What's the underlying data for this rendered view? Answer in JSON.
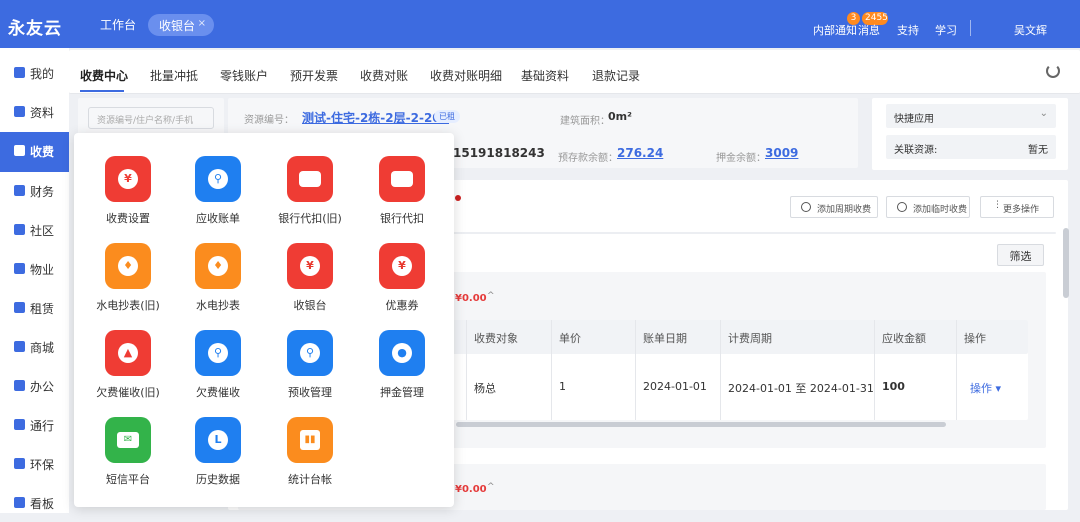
{
  "topbar": {
    "logo": "永友云",
    "workbench": "工作台",
    "open_tab": "收银台",
    "close": "×",
    "notice": "内部通知",
    "notice_badge": "3",
    "messages": "消息",
    "messages_badge": "2455",
    "support": "支持",
    "learn": "学习",
    "user": "吴文辉"
  },
  "sidebar": {
    "items": [
      {
        "label": "我的"
      },
      {
        "label": "资料"
      },
      {
        "label": "收费",
        "active": true
      },
      {
        "label": "财务"
      },
      {
        "label": "社区"
      },
      {
        "label": "物业"
      },
      {
        "label": "租赁"
      },
      {
        "label": "商城"
      },
      {
        "label": "办公"
      },
      {
        "label": "通行"
      },
      {
        "label": "环保"
      },
      {
        "label": "看板"
      }
    ]
  },
  "tabs": [
    "收费中心",
    "批量冲抵",
    "零钱账户",
    "预开发票",
    "收费对账",
    "收费对账明细",
    "基础资料",
    "退款记录"
  ],
  "search": {
    "placeholder": "资源编号/住户名称/手机"
  },
  "resource": {
    "label": "资源编号：",
    "value": "测试-住宅-2栋-2层-2-201",
    "tag": "已租",
    "area_label": "建筑面积：",
    "area_value": "0m²",
    "phone_partial": "15191818243",
    "prepay_label": "预存款余额：",
    "prepay_value": "276.24",
    "deposit_label": "押金余额：",
    "deposit_value": "3009"
  },
  "quick": {
    "label": "快捷应用",
    "linked_label": "关联资源:",
    "linked_value": "暂无"
  },
  "actions": {
    "add_periodic": "添加周期收费",
    "add_temp": "添加临时收费",
    "more": "更多操作",
    "filter": "筛选"
  },
  "amounts": [
    "¥0.00",
    "¥0.00"
  ],
  "table": {
    "headers": [
      "收费对象",
      "单价",
      "账单日期",
      "计费周期",
      "应收金额",
      "操作"
    ],
    "row": [
      "杨总",
      "1",
      "2024-01-01",
      "2024-01-01 至 2024-01-31",
      "100",
      "操作"
    ]
  },
  "apps": [
    {
      "label": "收费设置",
      "color": "#ef3c34",
      "icon": "coin-icon"
    },
    {
      "label": "应收账单",
      "color": "#1f7ff0",
      "icon": "key-icon"
    },
    {
      "label": "银行代扣(旧)",
      "color": "#ef3c34",
      "icon": "card-icon"
    },
    {
      "label": "银行代扣",
      "color": "#ef3c34",
      "icon": "card-icon"
    },
    {
      "label": "水电抄表(旧)",
      "color": "#fb8c1e",
      "icon": "drop-icon"
    },
    {
      "label": "水电抄表",
      "color": "#fb8c1e",
      "icon": "drop-icon"
    },
    {
      "label": "收银台",
      "color": "#ef3c34",
      "icon": "yuan-icon"
    },
    {
      "label": "优惠券",
      "color": "#ef3c34",
      "icon": "yuan-icon"
    },
    {
      "label": "欠费催收(旧)",
      "color": "#ef3c34",
      "icon": "bell-icon"
    },
    {
      "label": "欠费催收",
      "color": "#1f7ff0",
      "icon": "key-icon"
    },
    {
      "label": "预收管理",
      "color": "#1f7ff0",
      "icon": "key-icon"
    },
    {
      "label": "押金管理",
      "color": "#1f7ff0",
      "icon": "moneybag-icon"
    },
    {
      "label": "短信平台",
      "color": "#33b34a",
      "icon": "mail-icon"
    },
    {
      "label": "历史数据",
      "color": "#1f7ff0",
      "icon": "clock-icon"
    },
    {
      "label": "统计台帐",
      "color": "#fb8c1e",
      "icon": "chart-icon"
    }
  ]
}
